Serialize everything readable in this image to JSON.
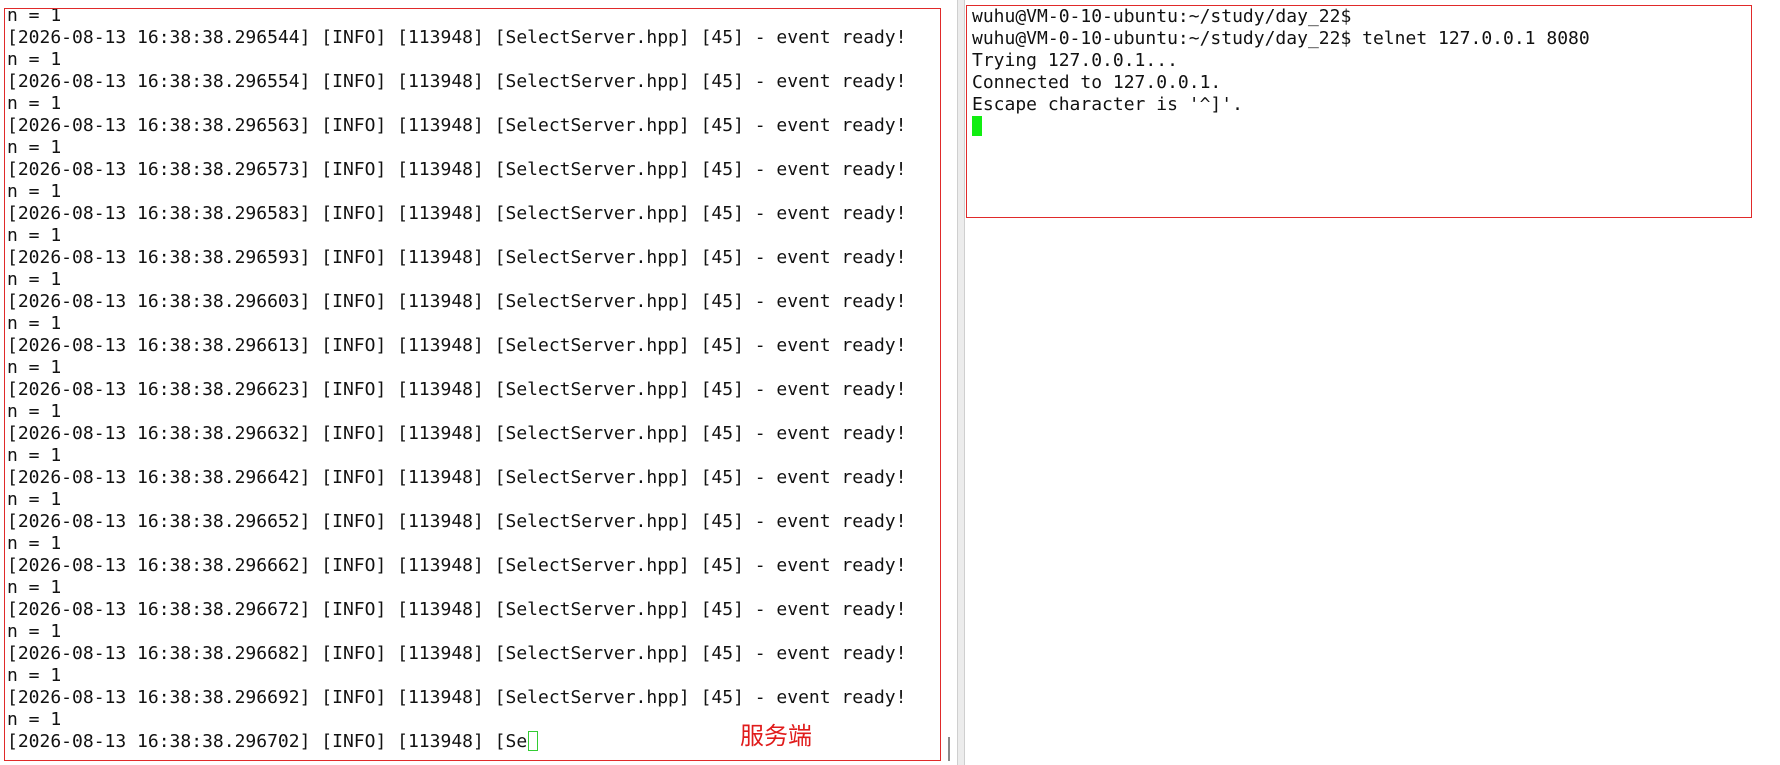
{
  "server_terminal": {
    "lines": [
      "n = 1",
      "[2026-08-13 16:38:38.296544] [INFO] [113948] [SelectServer.hpp] [45] - event ready!",
      "n = 1",
      "[2026-08-13 16:38:38.296554] [INFO] [113948] [SelectServer.hpp] [45] - event ready!",
      "n = 1",
      "[2026-08-13 16:38:38.296563] [INFO] [113948] [SelectServer.hpp] [45] - event ready!",
      "n = 1",
      "[2026-08-13 16:38:38.296573] [INFO] [113948] [SelectServer.hpp] [45] - event ready!",
      "n = 1",
      "[2026-08-13 16:38:38.296583] [INFO] [113948] [SelectServer.hpp] [45] - event ready!",
      "n = 1",
      "[2026-08-13 16:38:38.296593] [INFO] [113948] [SelectServer.hpp] [45] - event ready!",
      "n = 1",
      "[2026-08-13 16:38:38.296603] [INFO] [113948] [SelectServer.hpp] [45] - event ready!",
      "n = 1",
      "[2026-08-13 16:38:38.296613] [INFO] [113948] [SelectServer.hpp] [45] - event ready!",
      "n = 1",
      "[2026-08-13 16:38:38.296623] [INFO] [113948] [SelectServer.hpp] [45] - event ready!",
      "n = 1",
      "[2026-08-13 16:38:38.296632] [INFO] [113948] [SelectServer.hpp] [45] - event ready!",
      "n = 1",
      "[2026-08-13 16:38:38.296642] [INFO] [113948] [SelectServer.hpp] [45] - event ready!",
      "n = 1",
      "[2026-08-13 16:38:38.296652] [INFO] [113948] [SelectServer.hpp] [45] - event ready!",
      "n = 1",
      "[2026-08-13 16:38:38.296662] [INFO] [113948] [SelectServer.hpp] [45] - event ready!",
      "n = 1",
      "[2026-08-13 16:38:38.296672] [INFO] [113948] [SelectServer.hpp] [45] - event ready!",
      "n = 1",
      "[2026-08-13 16:38:38.296682] [INFO] [113948] [SelectServer.hpp] [45] - event ready!",
      "n = 1",
      "[2026-08-13 16:38:38.296692] [INFO] [113948] [SelectServer.hpp] [45] - event ready!",
      "n = 1"
    ],
    "partial_line": "[2026-08-13 16:38:38.296702] [INFO] [113948] [Se",
    "annotation": "服务端"
  },
  "client_terminal": {
    "lines": [
      "wuhu@VM-0-10-ubuntu:~/study/day_22$",
      "wuhu@VM-0-10-ubuntu:~/study/day_22$ telnet 127.0.0.1 8080",
      "Trying 127.0.0.1...",
      "Connected to 127.0.0.1.",
      "Escape character is '^]'."
    ]
  },
  "colors": {
    "annotation_red": "#e01b1b",
    "box_border_red": "#e02a2a",
    "cursor_green": "#11ee11"
  }
}
